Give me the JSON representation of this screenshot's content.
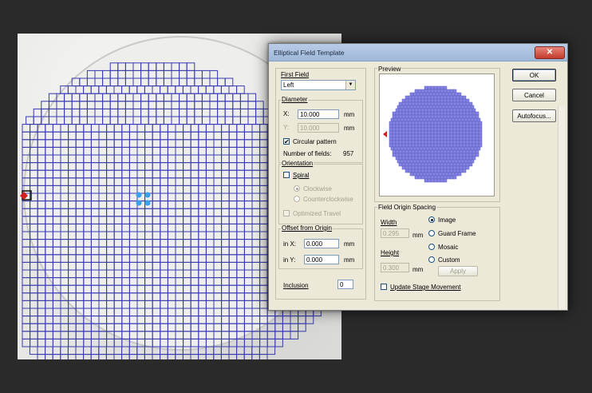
{
  "dialog": {
    "title": "Elliptical Field Template",
    "close_glyph": "✕",
    "first_field": {
      "label": "First Field",
      "value": "Left"
    },
    "diameter": {
      "label": "Diameter",
      "x_label": "X:",
      "x_value": "10.000",
      "x_unit": "mm",
      "y_label": "Y:",
      "y_value": "10.000",
      "y_unit": "mm",
      "circular_label": "Circular pattern",
      "circular_checked": "✔",
      "num_fields_label": "Number of fields:",
      "num_fields_value": "957"
    },
    "orientation": {
      "label": "Orientation",
      "spiral_label": "Spiral",
      "clockwise_label": "Clockwise",
      "counterclockwise_label": "Counterclockwise",
      "optimized_label": "Optimized Travel"
    },
    "offset": {
      "label": "Offset from Origin",
      "x_label": "in X:",
      "x_value": "0.000",
      "x_unit": "mm",
      "y_label": "in Y:",
      "y_value": "0.000",
      "y_unit": "mm"
    },
    "inclusion": {
      "label": "Inclusion",
      "value": "0"
    },
    "preview": {
      "label": "Preview"
    },
    "spacing": {
      "label": "Field Origin Spacing",
      "width_label": "Width",
      "width_value": "0.295",
      "width_unit": "mm",
      "height_label": "Height",
      "height_value": "0.300",
      "height_unit": "mm",
      "options": [
        "Image",
        "Guard Frame",
        "Mosaic",
        "Custom"
      ],
      "apply_label": "Apply",
      "update_label": "Update Stage Movement"
    },
    "buttons": {
      "ok": "OK",
      "cancel": "Cancel",
      "autofocus": "Autofocus..."
    }
  },
  "colors": {
    "grid_stroke": "#3a3ab0",
    "preview_fill": "#8585e0",
    "preview_stroke": "#5a5ac8",
    "origin_marker": "#d21e1e",
    "center_dots": "#3aa0f0"
  }
}
